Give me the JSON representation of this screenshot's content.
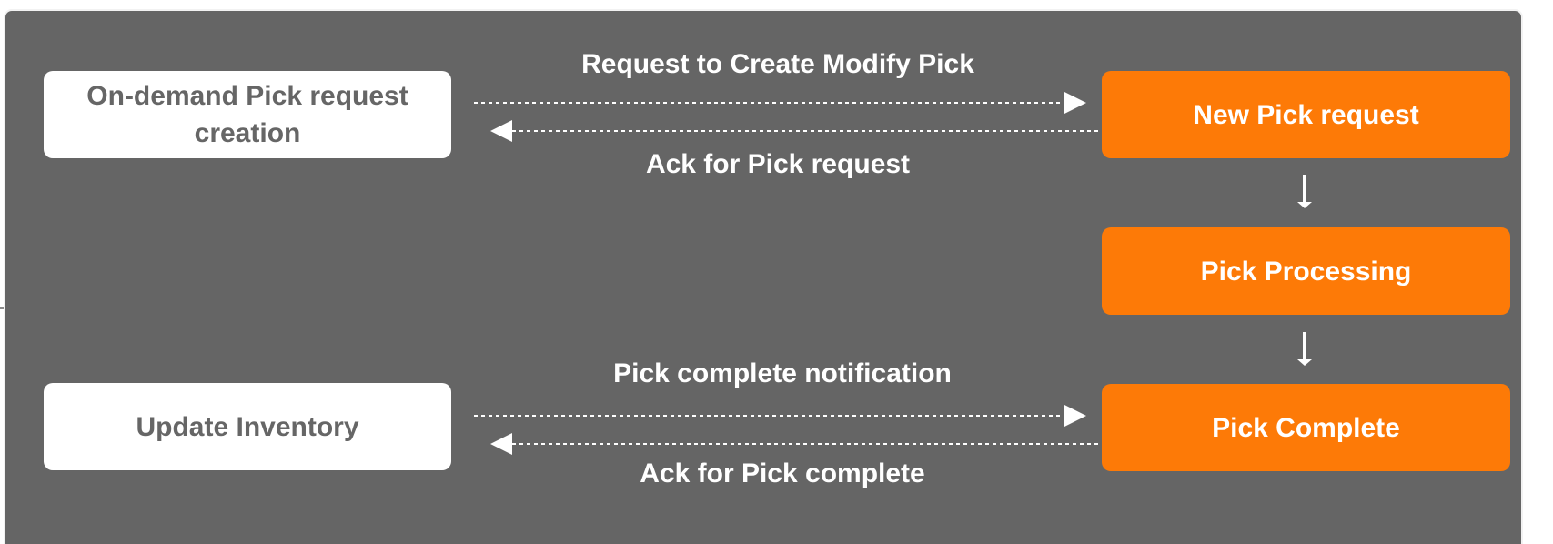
{
  "diagram": {
    "left_boxes": {
      "on_demand": "On-demand Pick request creation",
      "update_inventory": "Update Inventory"
    },
    "right_boxes": {
      "new_pick": "New Pick request",
      "processing": "Pick Processing",
      "complete": "Pick Complete"
    },
    "messages": {
      "request": "Request to Create Modify Pick",
      "ack_request": "Ack for Pick request",
      "notification": "Pick complete notification",
      "ack_complete": "Ack for Pick complete"
    },
    "colors": {
      "background": "#656565",
      "orange": "#fd7a07",
      "white_box_text": "#666666"
    }
  }
}
